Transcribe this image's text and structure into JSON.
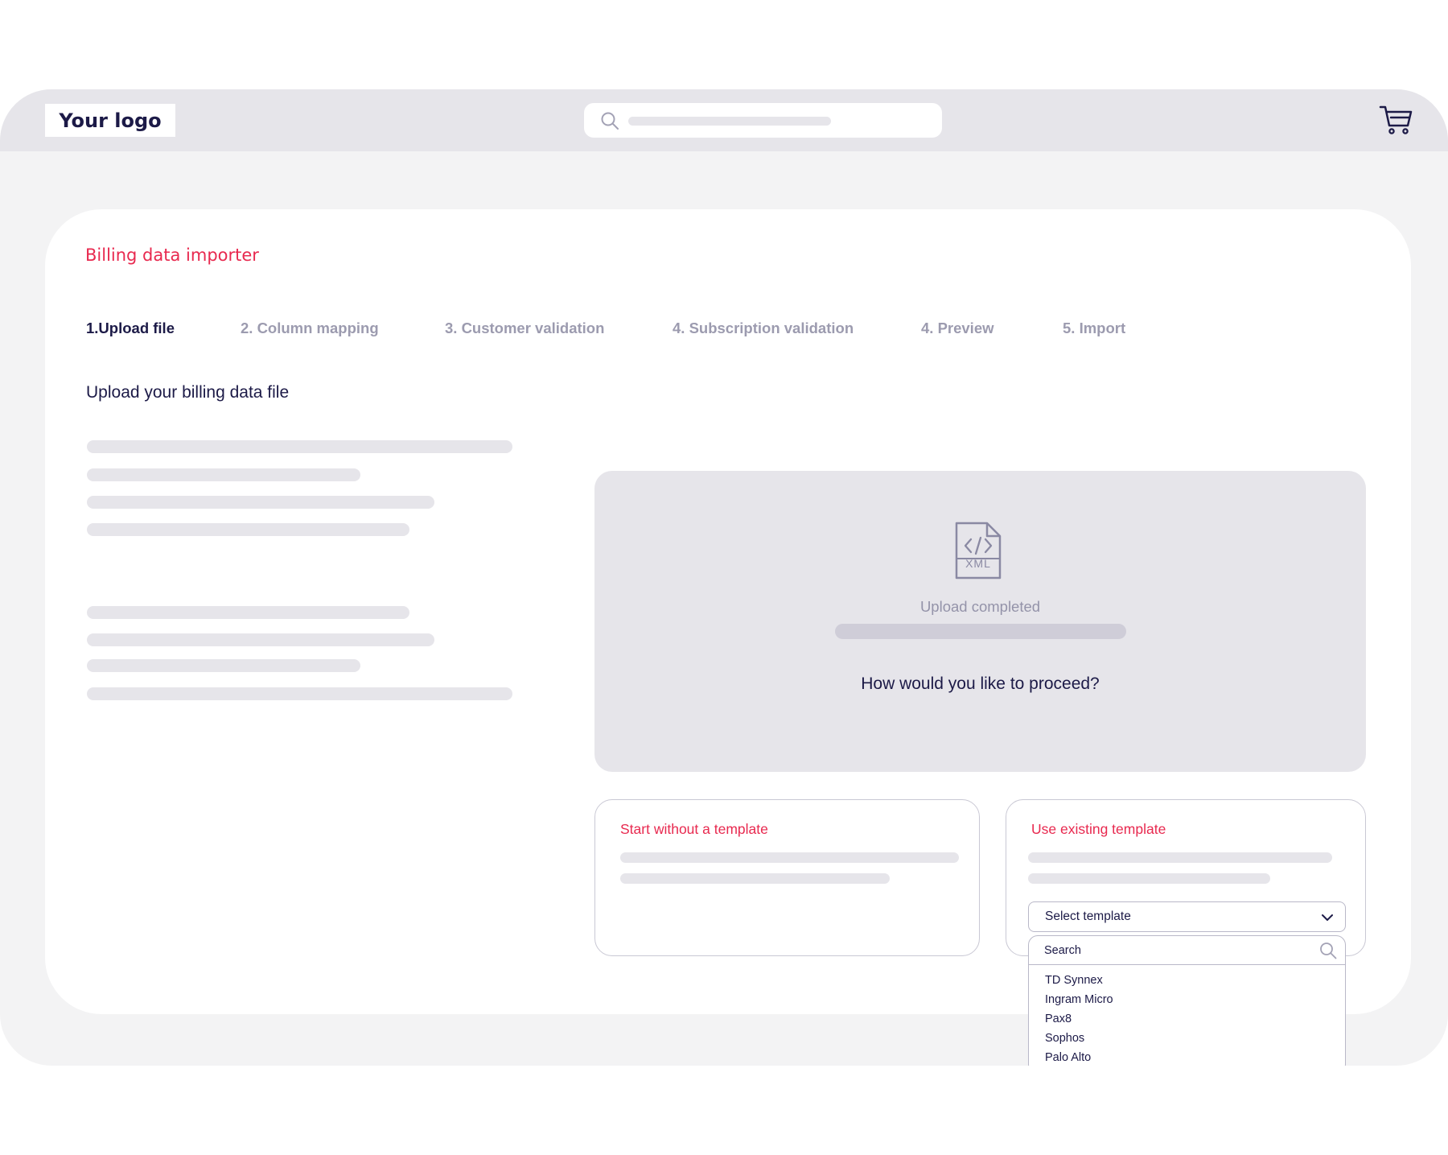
{
  "header": {
    "logo_text": "Your logo",
    "search_icon": "search-icon",
    "cart_icon": "cart-icon"
  },
  "importer": {
    "title": "Billing data importer",
    "steps": [
      {
        "label": "1.Upload file",
        "active": true
      },
      {
        "label": "2. Column mapping",
        "active": false
      },
      {
        "label": "3. Customer validation",
        "active": false
      },
      {
        "label": "4. Subscription validation",
        "active": false
      },
      {
        "label": "4. Preview",
        "active": false
      },
      {
        "label": "5. Import",
        "active": false
      }
    ],
    "upload_heading": "Upload your billing data file",
    "upload_panel": {
      "file_icon": "xml-file-icon",
      "file_icon_text": "XML",
      "status": "Upload completed",
      "progress": 1.0,
      "question": "How would you like to proceed?"
    },
    "options": {
      "no_template_label": "Start without a template",
      "existing_template_label": "Use existing template"
    },
    "template_select": {
      "selected": "Select template",
      "search_placeholder": "Search",
      "options": [
        "TD Synnex",
        "Ingram Micro",
        "Pax8",
        "Sophos",
        "Palo Alto"
      ]
    }
  },
  "colors": {
    "accent": "#e8294f",
    "text_dark": "#1c1a47",
    "text_muted": "#9c9baf",
    "panel_grey": "#e6e5ea",
    "page_bg": "#f3f3f4"
  }
}
